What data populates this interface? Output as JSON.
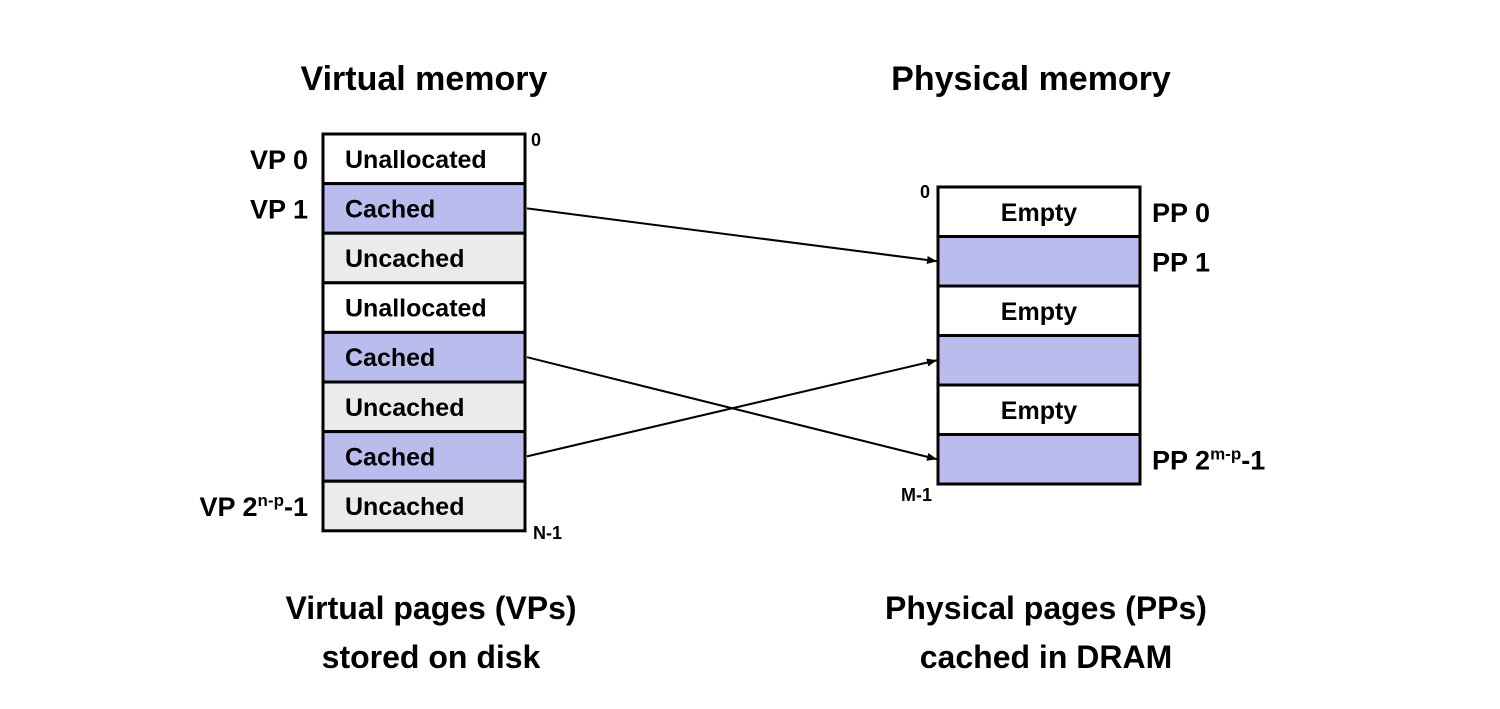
{
  "colors": {
    "cached": "#bbbcee",
    "uncached": "#ebebeb",
    "unallocated": "#ffffff",
    "empty": "#ffffff"
  },
  "virtual": {
    "title": "Virtual memory",
    "caption_line1": "Virtual pages (VPs)",
    "caption_line2": "stored on disk",
    "addr_top": "0",
    "addr_bottom": "N-1",
    "rows": [
      {
        "text": "Unallocated",
        "state": "unallocated",
        "label": "VP 0"
      },
      {
        "text": "Cached",
        "state": "cached",
        "label": "VP 1"
      },
      {
        "text": "Uncached",
        "state": "uncached"
      },
      {
        "text": "Unallocated",
        "state": "unallocated"
      },
      {
        "text": "Cached",
        "state": "cached"
      },
      {
        "text": "Uncached",
        "state": "uncached"
      },
      {
        "text": "Cached",
        "state": "cached"
      },
      {
        "text": "Uncached",
        "state": "uncached",
        "label": "VP 2",
        "label_sup": "n-p",
        "label_tail": "-1"
      }
    ]
  },
  "physical": {
    "title": "Physical memory",
    "caption_line1": "Physical pages (PPs)",
    "caption_line2": "cached in DRAM",
    "addr_top": "0",
    "addr_bottom": "M-1",
    "rows": [
      {
        "text": "Empty",
        "state": "empty",
        "label": "PP 0"
      },
      {
        "text": "",
        "state": "cached",
        "label": "PP 1"
      },
      {
        "text": "Empty",
        "state": "empty"
      },
      {
        "text": "",
        "state": "cached"
      },
      {
        "text": "Empty",
        "state": "empty"
      },
      {
        "text": "",
        "state": "cached",
        "label": "PP 2",
        "label_sup": "m-p",
        "label_tail": "-1"
      }
    ]
  },
  "mappings": [
    {
      "from_vp_row": 1,
      "to_pp_row": 1
    },
    {
      "from_vp_row": 4,
      "to_pp_row": 5
    },
    {
      "from_vp_row": 6,
      "to_pp_row": 3
    }
  ]
}
